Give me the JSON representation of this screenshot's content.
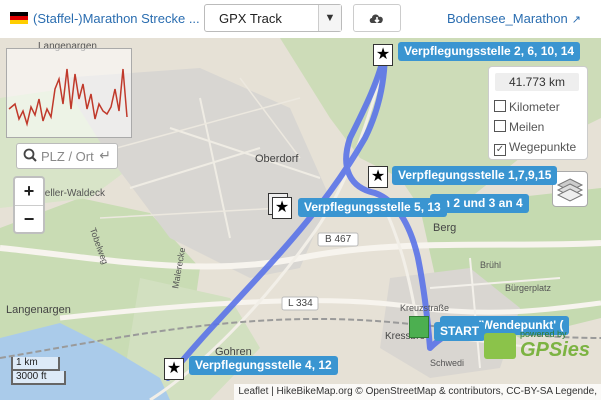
{
  "header": {
    "title_link": "(Staffel-)Marathon Strecke ...",
    "track_select": "GPX Track",
    "download_icon": "cloud-download-icon",
    "right_link": "Bodensee_Marathon",
    "flag_colors": [
      "#000000",
      "#dd0000",
      "#ffce00"
    ]
  },
  "map": {
    "search_placeholder": "PLZ / Ort",
    "zoom_in": "+",
    "zoom_out": "−",
    "distance": "41.773 km",
    "options": [
      {
        "label": "Kilometer",
        "checked": false
      },
      {
        "label": "Meilen",
        "checked": false
      },
      {
        "label": "Wegepunkte",
        "checked": true
      }
    ],
    "waypoint_labels": {
      "vp_2_6_10_14": "Verpflegungsstelle 2, 6, 10, 14",
      "vp_1_7_9_15": "Verpflegungsstelle 1,7,9,15",
      "vp_5_13": "Verpflegungsstelle 5, 13",
      "vp_obscured": "an 2 und 3 an 4",
      "wendepunkt": "gung 'Wendepunkt' (",
      "start": "START",
      "vp_4_12": "Verpflegungsstelle 4, 12"
    },
    "place_names": {
      "langenargen_top": "Langenargen",
      "oberdorf": "Oberdorf",
      "bierkeller": "Bierkeller-Waldeck",
      "berg": "Berg",
      "b467": "B 467",
      "l334": "L 334",
      "langenargen": "Langenargen",
      "gohren": "Gohren",
      "kressbronn": "Kressbro",
      "toeberweg": "Tobelweg",
      "bruehl": "Brühl",
      "malerecke": "Malerecke",
      "kreuzstrasse": "Kreuzstraße",
      "buergerplatz": "Bürgerplatz",
      "schwedi": "Schwedi"
    },
    "scale": {
      "metric": "1 km",
      "imperial": "3000 ft"
    },
    "attribution": "Leaflet | HikeBikeMap.org © OpenStreetMap & contributors, CC-BY-SA Legende,",
    "powered_by": "powered by",
    "gpsies": "GPSies",
    "colors": {
      "route": "#5a73e8",
      "label_bg": "#3a95d1",
      "link": "#2a6db0"
    }
  }
}
